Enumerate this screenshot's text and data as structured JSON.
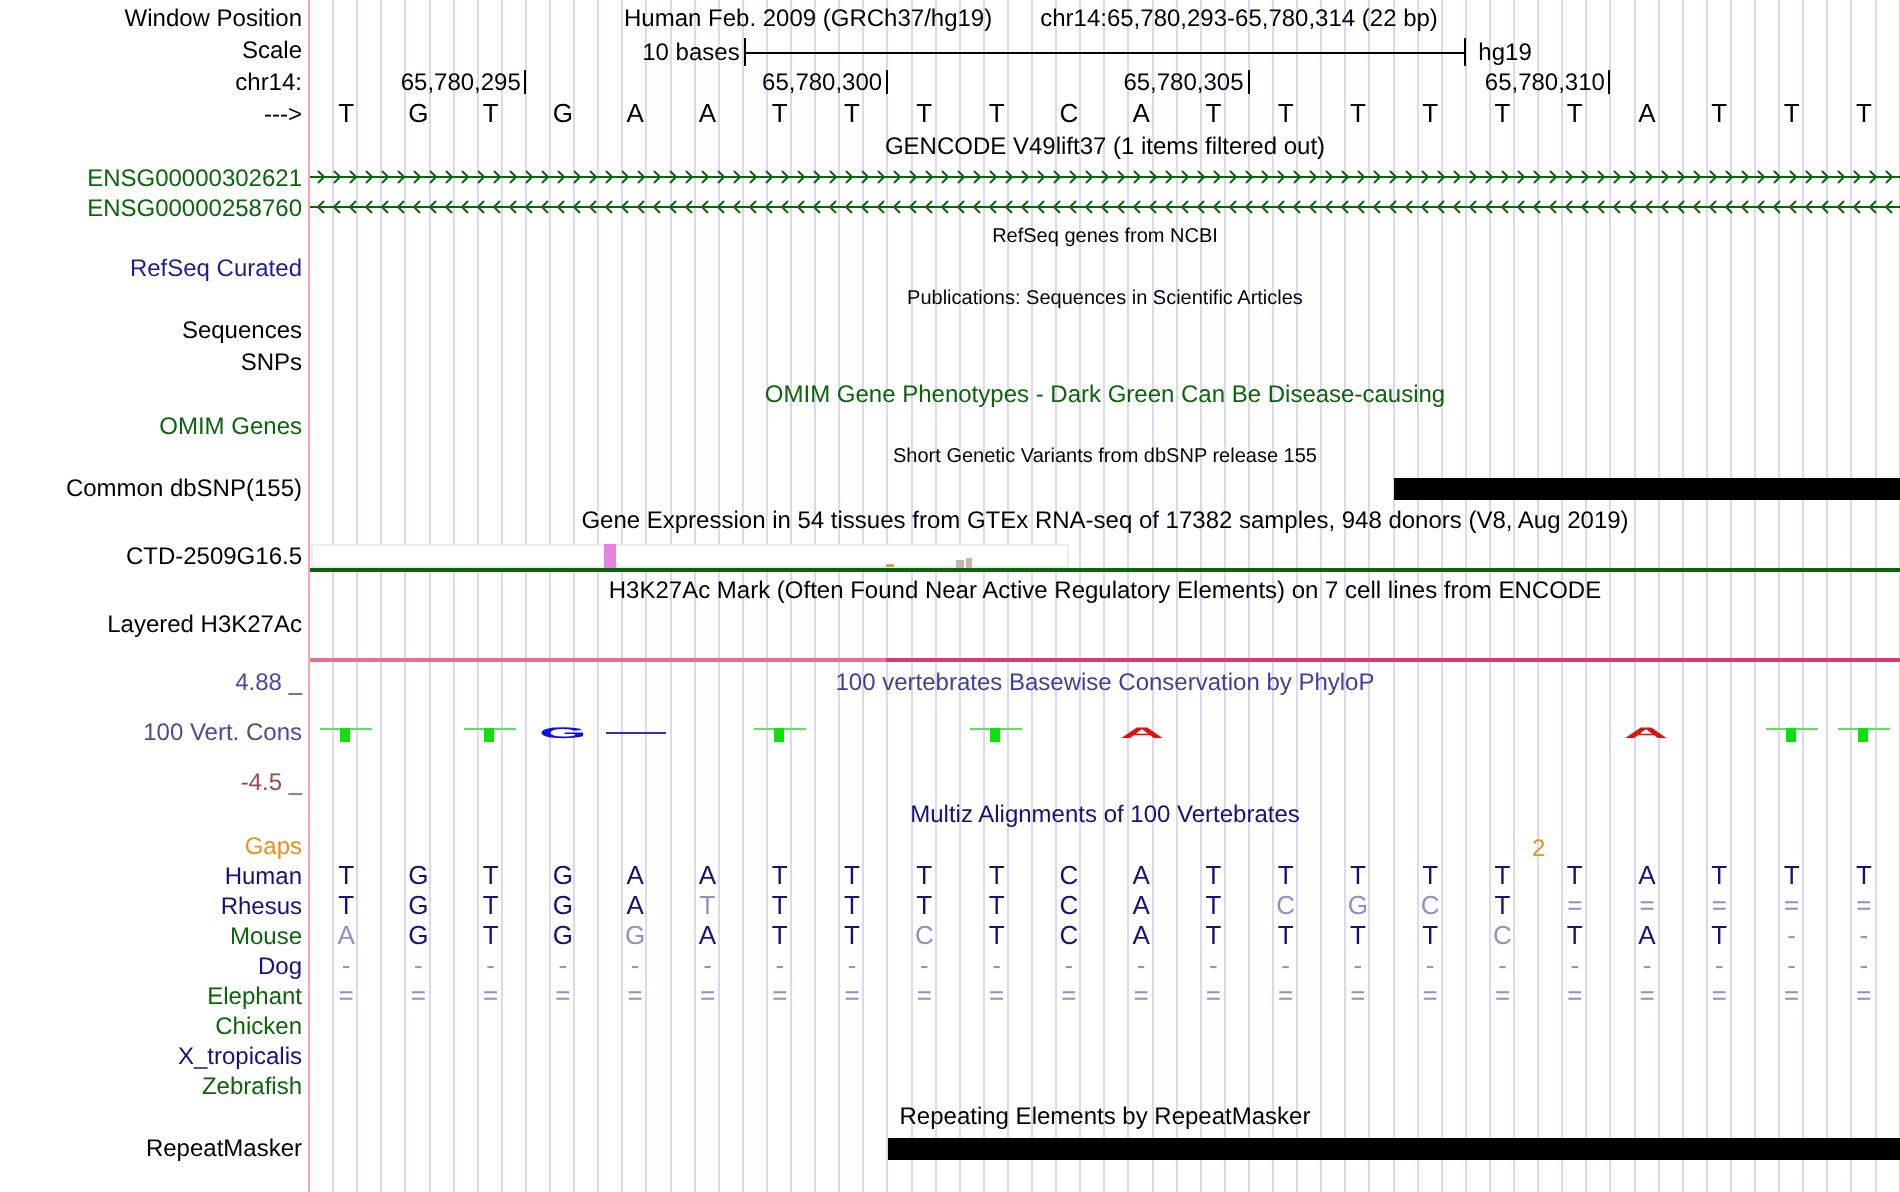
{
  "rows": [
    {
      "kind": "position",
      "label": "Window Position",
      "assembly": "Human Feb. 2009 (GRCh37/hg19)",
      "range": "chr14:65,780,293-65,780,314 (22 bp)"
    },
    {
      "kind": "scale",
      "label": "Scale",
      "span": "10 bases",
      "assembly": "hg19"
    },
    {
      "kind": "ruler",
      "label": "chr14:",
      "ticks": [
        "65,780,295",
        "65,780,300",
        "65,780,305",
        "65,780,310"
      ]
    },
    {
      "kind": "sequence",
      "label": "--->",
      "bases": [
        "T",
        "G",
        "T",
        "G",
        "A",
        "A",
        "T",
        "T",
        "T",
        "T",
        "C",
        "A",
        "T",
        "T",
        "T",
        "T",
        "T",
        "T",
        "A",
        "T",
        "T",
        "T"
      ]
    },
    {
      "kind": "title",
      "text": "GENCODE V49lift37 (1 items filtered out)",
      "color": "#000000"
    },
    {
      "kind": "gene_forward",
      "label": "ENSG00000302621",
      "color": "#0a640a"
    },
    {
      "kind": "gene_reverse",
      "label": "ENSG00000258760",
      "color": "#0a640a"
    },
    {
      "kind": "note",
      "text": "RefSeq genes from NCBI"
    },
    {
      "kind": "label",
      "label": "RefSeq Curated",
      "color": "#1f1f8a"
    },
    {
      "kind": "note",
      "text": "Publications: Sequences in Scientific Articles"
    },
    {
      "kind": "label",
      "label": "Sequences",
      "color": "#000000"
    },
    {
      "kind": "label",
      "label": "SNPs",
      "color": "#000000"
    },
    {
      "kind": "title",
      "text": "OMIM Gene Phenotypes - Dark Green Can Be Disease-causing",
      "color": "#0a640a"
    },
    {
      "kind": "label",
      "label": "OMIM Genes",
      "color": "#0a640a"
    },
    {
      "kind": "note",
      "text": "Short Genetic Variants from dbSNP release 155"
    },
    {
      "kind": "coverage",
      "label": "Common dbSNP(155)",
      "segments": [
        {
          "kind": "none"
        },
        {
          "kind": "none"
        },
        {
          "kind": "none"
        },
        {
          "kind": "none"
        },
        {
          "kind": "none"
        },
        {
          "kind": "none"
        },
        {
          "kind": "none"
        },
        {
          "kind": "none"
        },
        {
          "kind": "none"
        },
        {
          "kind": "none"
        },
        {
          "kind": "none"
        },
        {
          "kind": "none"
        },
        {
          "kind": "none"
        },
        {
          "kind": "none"
        },
        {
          "kind": "none"
        },
        {
          "kind": "block"
        },
        {
          "kind": "block"
        },
        {
          "kind": "block"
        },
        {
          "kind": "block"
        },
        {
          "kind": "block"
        },
        {
          "kind": "block"
        },
        {
          "kind": "block"
        }
      ]
    },
    {
      "kind": "title",
      "text": "Gene Expression in 54 tissues from GTEx RNA-seq of 17382 samples, 948 donors (V8, Aug 2019)",
      "color": "#000000"
    },
    {
      "kind": "expression",
      "label": "CTD-2509G16.5"
    },
    {
      "kind": "title",
      "text": "H3K27Ac Mark (Often Found Near Active Regulatory Elements) on 7 cell lines from ENCODE",
      "color": "#000000"
    },
    {
      "kind": "signal",
      "label": "Layered H3K27Ac"
    },
    {
      "kind": "axis_top",
      "axis": "4.88 _",
      "text": "100 vertebrates Basewise Conservation by PhyloP"
    },
    {
      "kind": "conservation",
      "label": "100 Vert. Cons",
      "marks": [
        {
          "kind": "bar"
        },
        {
          "kind": "none"
        },
        {
          "kind": "bar"
        },
        {
          "kind": "letter",
          "text": "G",
          "color": "#1010e0"
        },
        {
          "kind": "flat"
        },
        {
          "kind": "none"
        },
        {
          "kind": "bar"
        },
        {
          "kind": "none"
        },
        {
          "kind": "none"
        },
        {
          "kind": "bar"
        },
        {
          "kind": "none"
        },
        {
          "kind": "letter",
          "text": "A",
          "color": "#e01010"
        },
        {
          "kind": "none"
        },
        {
          "kind": "none"
        },
        {
          "kind": "none"
        },
        {
          "kind": "none"
        },
        {
          "kind": "none"
        },
        {
          "kind": "none"
        },
        {
          "kind": "letter",
          "text": "A",
          "color": "#e01010"
        },
        {
          "kind": "none"
        },
        {
          "kind": "bar"
        },
        {
          "kind": "bar"
        }
      ]
    },
    {
      "kind": "axis_bottom",
      "axis": "-4.5 _"
    },
    {
      "kind": "title",
      "text": "Multiz Alignments of 100 Vertebrates",
      "color": "#12127a"
    },
    {
      "kind": "gaps",
      "label": "Gaps",
      "marks": [
        {
          "kind": "none"
        },
        {
          "kind": "none"
        },
        {
          "kind": "none"
        },
        {
          "kind": "none"
        },
        {
          "kind": "none"
        },
        {
          "kind": "none"
        },
        {
          "kind": "none"
        },
        {
          "kind": "none"
        },
        {
          "kind": "none"
        },
        {
          "kind": "none"
        },
        {
          "kind": "none"
        },
        {
          "kind": "none"
        },
        {
          "kind": "none"
        },
        {
          "kind": "none"
        },
        {
          "kind": "none"
        },
        {
          "kind": "none"
        },
        {
          "kind": "count",
          "text": "2"
        },
        {
          "kind": "none"
        },
        {
          "kind": "none"
        },
        {
          "kind": "none"
        },
        {
          "kind": "none"
        },
        {
          "kind": "none"
        }
      ]
    },
    {
      "kind": "alignment",
      "label": "Human",
      "color": "#12127a",
      "bases": [
        "T",
        "G",
        "T",
        "G",
        "A",
        "A",
        "T",
        "T",
        "T",
        "T",
        "C",
        "A",
        "T",
        "T",
        "T",
        "T",
        "T",
        "T",
        "A",
        "T",
        "T",
        "T"
      ]
    },
    {
      "kind": "alignment",
      "label": "Rhesus",
      "color": "#12127a",
      "bases": [
        "T",
        "G",
        "T",
        "G",
        "A",
        "T",
        "T",
        "T",
        "T",
        "T",
        "C",
        "A",
        "T",
        "C",
        "G",
        "C",
        "T",
        "=",
        "=",
        "=",
        "=",
        "="
      ]
    },
    {
      "kind": "alignment",
      "label": "Mouse",
      "color": "#0a640a",
      "bases": [
        "A",
        "G",
        "T",
        "G",
        "G",
        "A",
        "T",
        "T",
        "C",
        "T",
        "C",
        "A",
        "T",
        "T",
        "T",
        "T",
        "C",
        "T",
        "A",
        "T",
        "-",
        "-"
      ]
    },
    {
      "kind": "alignment",
      "label": "Dog",
      "color": "#12127a",
      "bases": [
        "-",
        "-",
        "-",
        "-",
        "-",
        "-",
        "-",
        "-",
        "-",
        "-",
        "-",
        "-",
        "-",
        "-",
        "-",
        "-",
        "-",
        "-",
        "-",
        "-",
        "-",
        "-"
      ]
    },
    {
      "kind": "alignment",
      "label": "Elephant",
      "color": "#0a640a",
      "bases": [
        "=",
        "=",
        "=",
        "=",
        "=",
        "=",
        "=",
        "=",
        "=",
        "=",
        "=",
        "=",
        "=",
        "=",
        "=",
        "=",
        "=",
        "=",
        "=",
        "=",
        "=",
        "="
      ]
    },
    {
      "kind": "alignment",
      "label": "Chicken",
      "color": "#0a640a"
    },
    {
      "kind": "alignment",
      "label": "X_tropicalis",
      "color": "#12127a"
    },
    {
      "kind": "alignment",
      "label": "Zebrafish",
      "color": "#0a640a"
    },
    {
      "kind": "title",
      "text": "Repeating Elements by RepeatMasker",
      "color": "#000000"
    },
    {
      "kind": "coverage",
      "label": "RepeatMasker",
      "segments": [
        {
          "kind": "none"
        },
        {
          "kind": "none"
        },
        {
          "kind": "none"
        },
        {
          "kind": "none"
        },
        {
          "kind": "none"
        },
        {
          "kind": "none"
        },
        {
          "kind": "none"
        },
        {
          "kind": "none"
        },
        {
          "kind": "block"
        },
        {
          "kind": "block"
        },
        {
          "kind": "block"
        },
        {
          "kind": "block"
        },
        {
          "kind": "block"
        },
        {
          "kind": "block"
        },
        {
          "kind": "block"
        },
        {
          "kind": "block"
        },
        {
          "kind": "block"
        },
        {
          "kind": "block"
        },
        {
          "kind": "block"
        },
        {
          "kind": "block"
        },
        {
          "kind": "block"
        },
        {
          "kind": "block"
        }
      ]
    }
  ]
}
